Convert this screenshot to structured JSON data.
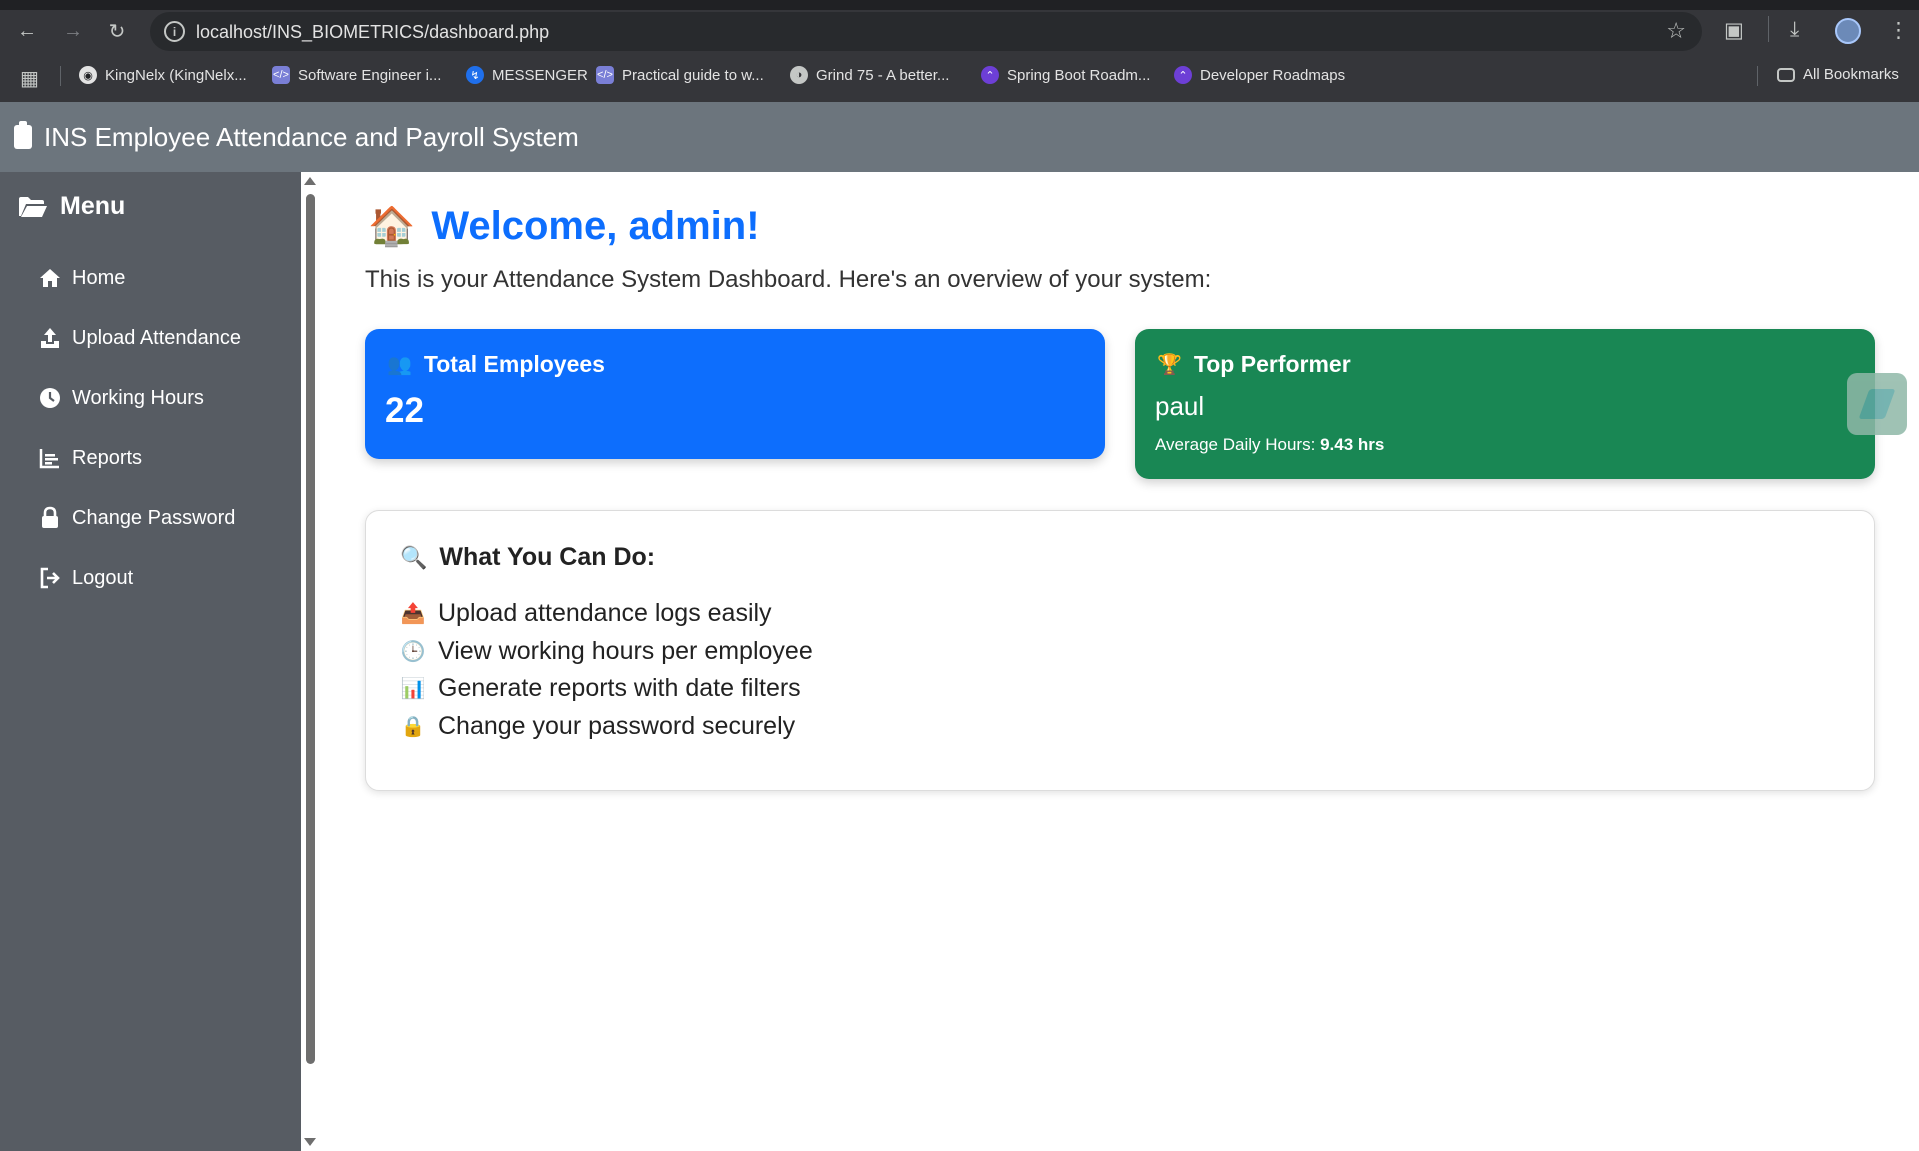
{
  "browser": {
    "url": "localhost/INS_BIOMETRICS/dashboard.php",
    "bookmarks": [
      {
        "label": "KingNelx (KingNelx...",
        "icon": "github-icon"
      },
      {
        "label": "Software Engineer i...",
        "icon": "code-icon"
      },
      {
        "label": "MESSENGER",
        "icon": "messenger-icon"
      },
      {
        "label": "Practical guide to w...",
        "icon": "code-icon"
      },
      {
        "label": "Grind 75 - A better...",
        "icon": "globe-icon"
      },
      {
        "label": "Spring Boot Roadm...",
        "icon": "roadmap-icon"
      },
      {
        "label": "Developer Roadmaps",
        "icon": "roadmap-icon"
      }
    ],
    "all_bookmarks": "All Bookmarks"
  },
  "app": {
    "title": "INS Employee Attendance and Payroll System"
  },
  "sidebar": {
    "title": "Menu",
    "items": [
      {
        "label": "Home",
        "icon": "home-icon"
      },
      {
        "label": "Upload Attendance",
        "icon": "upload-icon"
      },
      {
        "label": "Working Hours",
        "icon": "clock-icon"
      },
      {
        "label": "Reports",
        "icon": "chart-icon"
      },
      {
        "label": "Change Password",
        "icon": "lock-icon"
      },
      {
        "label": "Logout",
        "icon": "logout-icon"
      }
    ]
  },
  "main": {
    "welcome": "Welcome, admin!",
    "intro": "This is your Attendance System Dashboard. Here's an overview of your system:",
    "total_employees": {
      "title": "Total Employees",
      "value": "22"
    },
    "top_performer": {
      "title": "Top Performer",
      "name": "paul",
      "avg_label": "Average Daily Hours:",
      "avg_value": "9.43 hrs"
    },
    "what_you_can_do": {
      "title": "What You Can Do:",
      "items": [
        "Upload attendance logs easily",
        "View working hours per employee",
        "Generate reports with date filters",
        "Change your password securely"
      ]
    }
  },
  "colors": {
    "primary": "#0d6efd",
    "success": "#198754",
    "header": "#6c757d",
    "sidebar": "#575c63"
  }
}
